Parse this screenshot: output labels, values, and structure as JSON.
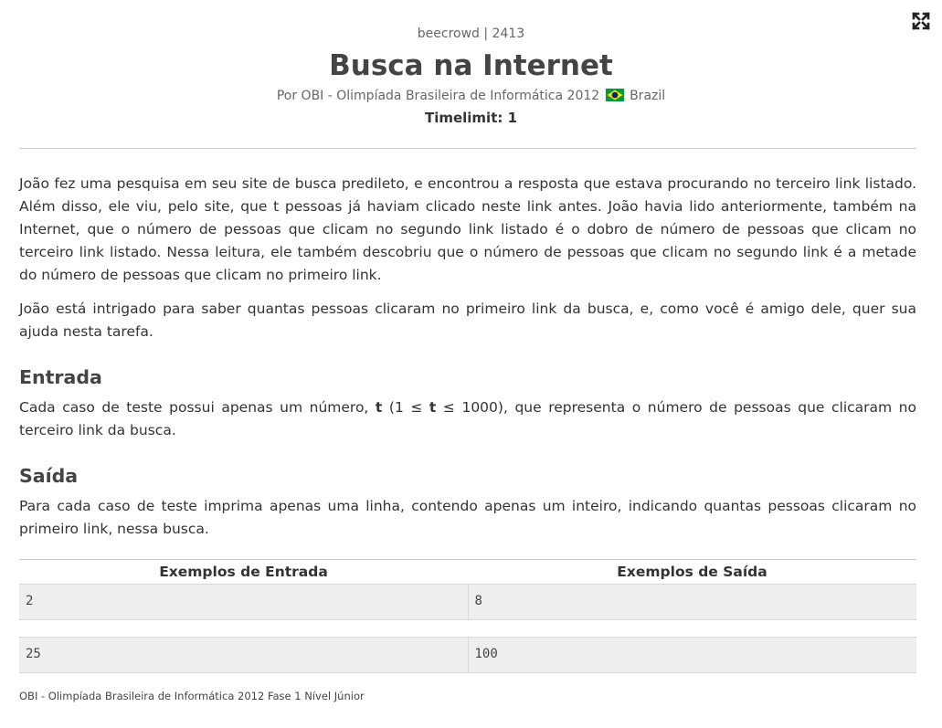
{
  "header": {
    "problem_id": "beecrowd | 2413",
    "title": "Busca na Internet",
    "author_prefix": "Por OBI - Olimpíada Brasileira de Informática 2012",
    "country": "Brazil",
    "timelimit": "Timelimit: 1"
  },
  "description": {
    "paragraph1": "João fez uma pesquisa em seu site de busca predileto, e encontrou a resposta que estava procurando no terceiro link listado. Além disso, ele viu, pelo site, que t pessoas já haviam clicado neste link antes. João havia lido anteriormente, também na Internet, que o número de pessoas que clicam no segundo link listado é o dobro de número de pessoas que clicam no terceiro link listado. Nessa leitura, ele também descobriu que o número de pessoas que clicam no segundo link é a metade do número de pessoas que clicam no primeiro link.",
    "paragraph2": "João está intrigado para saber quantas pessoas clicaram no primeiro link da busca, e, como você é amigo dele, quer sua ajuda nesta tarefa."
  },
  "input_section": {
    "title": "Entrada",
    "text_before": "Cada caso de teste possui apenas um número, ",
    "var": "t",
    "range_open": " (1 ≤ ",
    "range_var": "t",
    "range_close": " ≤ 1000)",
    "text_after": ", que representa o número de pessoas que clicaram no terceiro link da busca."
  },
  "output_section": {
    "title": "Saída",
    "text": "Para cada caso de teste imprima apenas uma linha, contendo apenas um inteiro, indicando quantas pessoas clicaram no primeiro link, nessa busca."
  },
  "examples": {
    "input_header": "Exemplos de Entrada",
    "output_header": "Exemplos de Saída",
    "rows": [
      {
        "input": "2",
        "output": "8"
      },
      {
        "input": "25",
        "output": "100"
      }
    ]
  },
  "footer": {
    "source": "OBI - Olimpíada Brasileira de Informática 2012 Fase 1 Nível Júnior"
  },
  "icons": {
    "fullscreen": "expand-icon",
    "flag": "brazil-flag-icon"
  },
  "colors": {
    "flag_green": "#009b3a",
    "flag_yellow": "#fedf00",
    "flag_blue": "#002776"
  }
}
